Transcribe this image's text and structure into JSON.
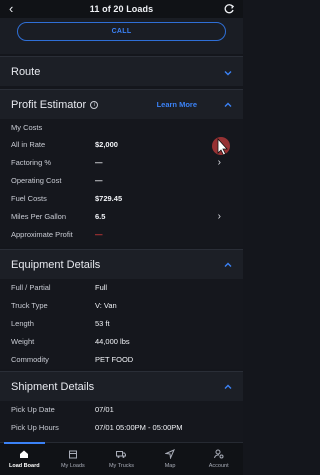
{
  "header": {
    "title": "11 of 20 Loads"
  },
  "call": {
    "label": "CALL"
  },
  "route": {
    "title": "Route"
  },
  "profit": {
    "title": "Profit Estimator",
    "learn_more": "Learn More",
    "my_costs": "My Costs",
    "rows": [
      {
        "label": "All in Rate",
        "value": "$2,000"
      },
      {
        "label": "Factoring %",
        "value": "—"
      },
      {
        "label": "Operating Cost",
        "value": "—"
      },
      {
        "label": "Fuel Costs",
        "value": "$729.45"
      },
      {
        "label": "Miles Per Gallon",
        "value": "6.5"
      },
      {
        "label": "Approximate Profit",
        "value": "—"
      }
    ]
  },
  "equipment": {
    "title": "Equipment Details",
    "rows": [
      {
        "label": "Full / Partial",
        "value": "Full"
      },
      {
        "label": "Truck Type",
        "value": "V: Van"
      },
      {
        "label": "Length",
        "value": "53 ft"
      },
      {
        "label": "Weight",
        "value": "44,000 lbs"
      },
      {
        "label": "Commodity",
        "value": "PET FOOD"
      }
    ]
  },
  "shipment": {
    "title": "Shipment Details",
    "rows": [
      {
        "label": "Pick Up Date",
        "value": "07/01"
      },
      {
        "label": "Pick Up Hours",
        "value": "07/01 05:00PM - 05:00PM"
      }
    ]
  },
  "tabs": [
    {
      "label": "Load Board",
      "icon": "home-icon",
      "active": true
    },
    {
      "label": "My Loads",
      "icon": "box-icon",
      "active": false
    },
    {
      "label": "My Trucks",
      "icon": "truck-icon",
      "active": false
    },
    {
      "label": "Map",
      "icon": "navigation-arrow-icon",
      "active": false
    },
    {
      "label": "Account",
      "icon": "account-settings-icon",
      "active": false
    }
  ],
  "colors": {
    "accent": "#3b82f6",
    "negative": "#e23c3c",
    "background": "#14161c"
  }
}
